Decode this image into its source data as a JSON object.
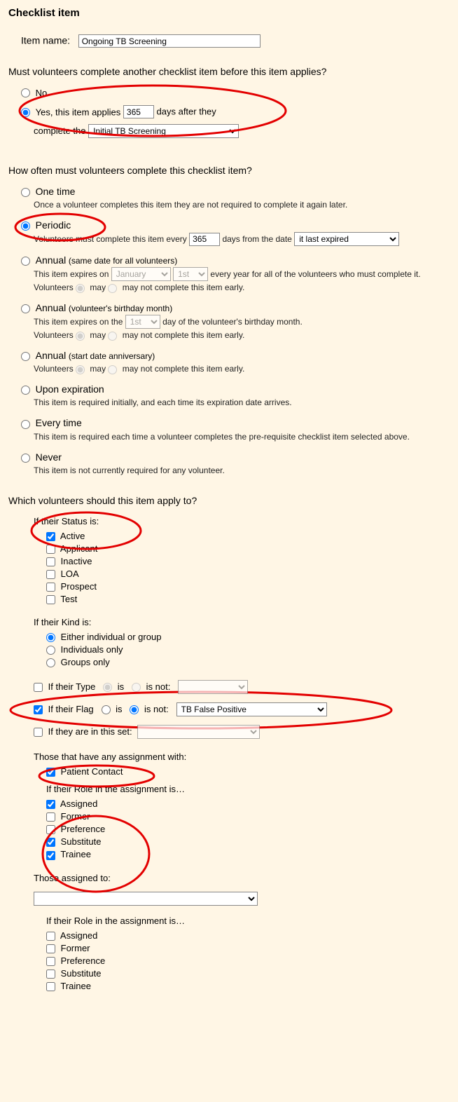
{
  "title": "Checklist item",
  "item_name_label": "Item name:",
  "item_name_value": "Ongoing TB Screening",
  "q1": "Must volunteers complete another checklist item before this item applies?",
  "prereq": {
    "no": "No",
    "yes_prefix": "Yes, this item applies",
    "yes_days": "365",
    "yes_mid": "days after they",
    "yes_line2": "complete the",
    "yes_select": "Initial TB Screening"
  },
  "q2": "How often must volunteers complete this checklist item?",
  "freq": {
    "one_time": "One time",
    "one_time_sub": "Once a volunteer completes this item they are not required to complete it again later.",
    "periodic": "Periodic",
    "periodic_sub_prefix": "Volunteers must complete this item every",
    "periodic_days": "365",
    "periodic_mid": "days from the date",
    "periodic_select": "it last expired",
    "annual_same": "Annual",
    "annual_same_paren": "(same date for all volunteers)",
    "annual_same_sub1": "This item expires on",
    "annual_same_month": "January",
    "annual_same_day": "1st",
    "annual_same_sub2": "every year for all of the volunteers who must complete it. Volunteers",
    "may": "may",
    "may_not": "may not",
    "complete_early": " complete this item early.",
    "annual_bday": "Annual",
    "annual_bday_paren": "(volunteer's birthday month)",
    "annual_bday_sub1": "This item expires on the",
    "annual_bday_day": "1st",
    "annual_bday_sub2": "day of the volunteer's birthday month.",
    "annual_bday_sub3": "Volunteers",
    "annual_start": "Annual",
    "annual_start_paren": "(start date anniversary)",
    "annual_start_sub": "Volunteers",
    "upon_exp": "Upon expiration",
    "upon_exp_sub": "This item is required initially, and each time its expiration date arrives.",
    "every_time": "Every time",
    "every_time_sub": "This item is required each time a volunteer completes the pre-requisite checklist item selected above.",
    "never": "Never",
    "never_sub": "This item is not currently required for any volunteer."
  },
  "q3": "Which volunteers should this item apply to?",
  "apply": {
    "status_head": "If their Status is:",
    "status_items": [
      "Active",
      "Applicant",
      "Inactive",
      "LOA",
      "Prospect",
      "Test"
    ],
    "kind_head": "If their Kind is:",
    "kind_items": [
      "Either individual or group",
      "Individuals only",
      "Groups only"
    ],
    "type_label": "If their Type",
    "is": "is",
    "is_not": "is not:",
    "flag_label": "If their Flag",
    "flag_select": "TB False Positive",
    "set_label": "If they are in this set:",
    "assign_any_head": "Those that have any assignment with:",
    "patient_contact": "Patient Contact",
    "role_head": "If their Role in the assignment is…",
    "roles": [
      "Assigned",
      "Former",
      "Preference",
      "Substitute",
      "Trainee"
    ],
    "assigned_to_head": "Those assigned to:"
  }
}
